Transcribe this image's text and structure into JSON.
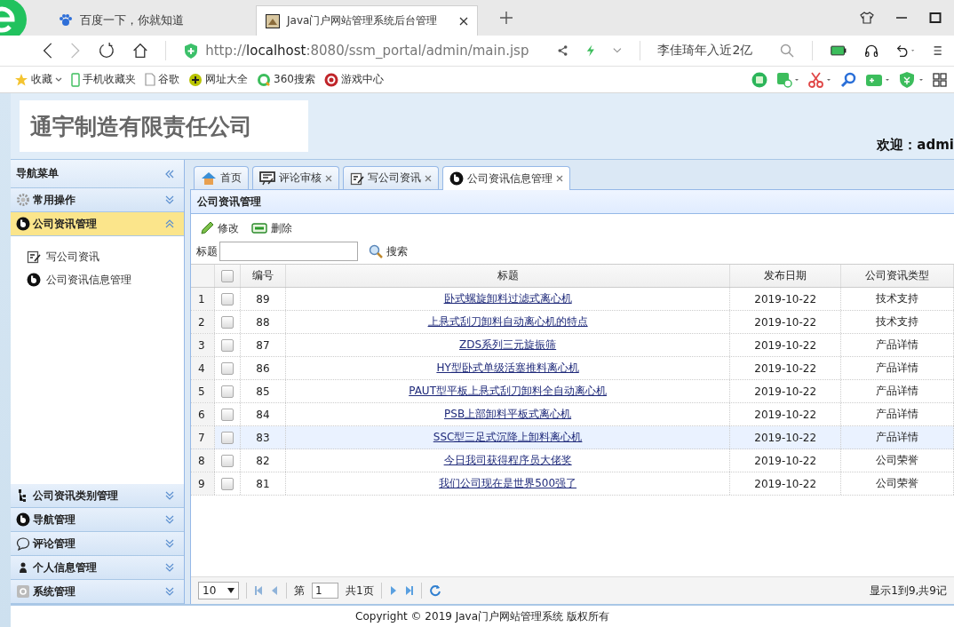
{
  "browser": {
    "tabs": [
      {
        "label": "百度一下，你就知道",
        "selected": false
      },
      {
        "label": "Java门户网站管理系统后台管理",
        "selected": true
      }
    ],
    "url": {
      "host": "localhost",
      "prefix": "http://",
      "rest": ":8080/ssm_portal/admin/main.jsp"
    },
    "search": {
      "value": "李佳琦年入近2亿"
    },
    "bookmarks": [
      "收藏",
      "手机收藏夹",
      "谷歌",
      "网址大全",
      "360搜索",
      "游戏中心"
    ]
  },
  "header": {
    "company": "通宇制造有限责任公司",
    "welcome_label": "欢迎：",
    "user": "admi"
  },
  "sidebar": {
    "title": "导航菜单",
    "panels": [
      {
        "label": "常用操作",
        "expanded": false
      },
      {
        "label": "公司资讯管理",
        "expanded": true,
        "items": [
          "写公司资讯",
          "公司资讯信息管理"
        ]
      },
      {
        "label": "公司资讯类别管理",
        "expanded": false
      },
      {
        "label": "导航管理",
        "expanded": false
      },
      {
        "label": "评论管理",
        "expanded": false
      },
      {
        "label": "个人信息管理",
        "expanded": false
      },
      {
        "label": "系统管理",
        "expanded": false
      }
    ]
  },
  "tabs": [
    {
      "label": "首页",
      "selected": false,
      "closable": false
    },
    {
      "label": "评论审核",
      "selected": false,
      "closable": true
    },
    {
      "label": "写公司资讯",
      "selected": false,
      "closable": true
    },
    {
      "label": "公司资讯信息管理",
      "selected": true,
      "closable": true
    }
  ],
  "panel_title": "公司资讯管理",
  "toolbar": [
    "修改",
    "删除"
  ],
  "search": {
    "label": "标题",
    "button": "搜索"
  },
  "table": {
    "all_checked": false,
    "columns": [
      "编号",
      "标题",
      "发布日期",
      "公司资讯类型"
    ],
    "rows": [
      {
        "num": "1",
        "id": "89",
        "title": "卧式螺旋卸料过滤式离心机",
        "date": "2019-10-22",
        "type": "技术支持",
        "checked": false,
        "selected": false
      },
      {
        "num": "2",
        "id": "88",
        "title": "上悬式刮刀卸料自动离心机的特点",
        "date": "2019-10-22",
        "type": "技术支持",
        "checked": false,
        "selected": false
      },
      {
        "num": "3",
        "id": "87",
        "title": "ZDS系列三元旋振筛",
        "date": "2019-10-22",
        "type": "产品详情",
        "checked": false,
        "selected": false
      },
      {
        "num": "4",
        "id": "86",
        "title": "HY型卧式单级活塞推料离心机",
        "date": "2019-10-22",
        "type": "产品详情",
        "checked": false,
        "selected": false
      },
      {
        "num": "5",
        "id": "85",
        "title": "PAUT型平板上悬式刮刀卸料全自动离心机",
        "date": "2019-10-22",
        "type": "产品详情",
        "checked": false,
        "selected": false
      },
      {
        "num": "6",
        "id": "84",
        "title": "PSB上部卸料平板式离心机",
        "date": "2019-10-22",
        "type": "产品详情",
        "checked": false,
        "selected": false
      },
      {
        "num": "7",
        "id": "83",
        "title": "SSC型三足式沉降上卸料离心机",
        "date": "2019-10-22",
        "type": "产品详情",
        "checked": false,
        "selected": true
      },
      {
        "num": "8",
        "id": "82",
        "title": "今日我司获得程序员大佬奖",
        "date": "2019-10-22",
        "type": "公司荣誉",
        "checked": false,
        "selected": false
      },
      {
        "num": "9",
        "id": "81",
        "title": "我们公司现在是世界500强了",
        "date": "2019-10-22",
        "type": "公司荣誉",
        "checked": false,
        "selected": false
      }
    ]
  },
  "pager": {
    "page_size": "10",
    "page_label": "第",
    "page": "1",
    "total_pages": "共1页",
    "summary": "显示1到9,共9记"
  },
  "footer": "Copyright © 2019 Java门户网站管理系统 版权所有"
}
